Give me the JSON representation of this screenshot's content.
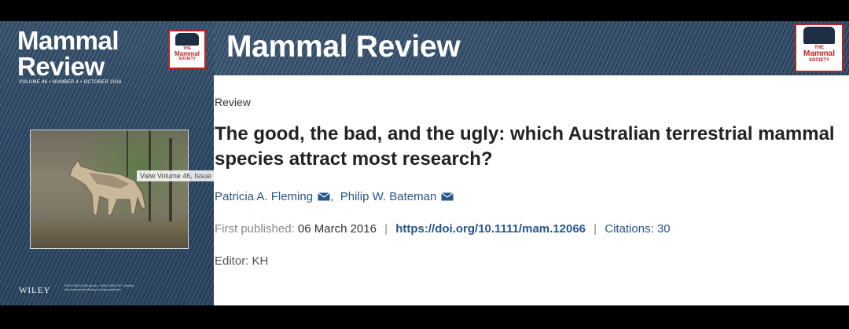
{
  "cover": {
    "journal_title_line1": "Mammal",
    "journal_title_line2": "Review",
    "issue_line": "VOLUME 46 • NUMBER 4 • OCTOBER 2016",
    "society_logo": {
      "the": "THE",
      "name": "Mammal",
      "sub": "SOCIETY"
    },
    "tooltip": "View Volume 46, Issue",
    "publisher": "WILEY",
    "fine_print_1": "ISSN 0305-1838 (print) • ISSN 1365-2907 (online)",
    "fine_print_2": "http://wileyonlinelibrary.com/journal/mam"
  },
  "banner": {
    "journal_title": "Mammal Review",
    "society_logo": {
      "the": "THE",
      "name": "Mammal",
      "sub": "SOCIETY"
    }
  },
  "article": {
    "type": "Review",
    "title": "The good, the bad, and the ugly: which Australian terrestrial mammal species attract most research?",
    "authors": [
      {
        "name": "Patricia A. Fleming",
        "icon": "envelope-icon"
      },
      {
        "name": "Philip W. Bateman",
        "icon": "envelope-icon"
      }
    ],
    "author_separator": ",",
    "first_published_label": "First published:",
    "first_published_value": "06 March 2016",
    "doi": "https://doi.org/10.1111/mam.12066",
    "citations_label": "Citations: 30",
    "meta_separator": "|",
    "editor": "Editor: KH"
  },
  "colors": {
    "link": "#27558a",
    "banner": "#345170",
    "society_red": "#b22222"
  }
}
